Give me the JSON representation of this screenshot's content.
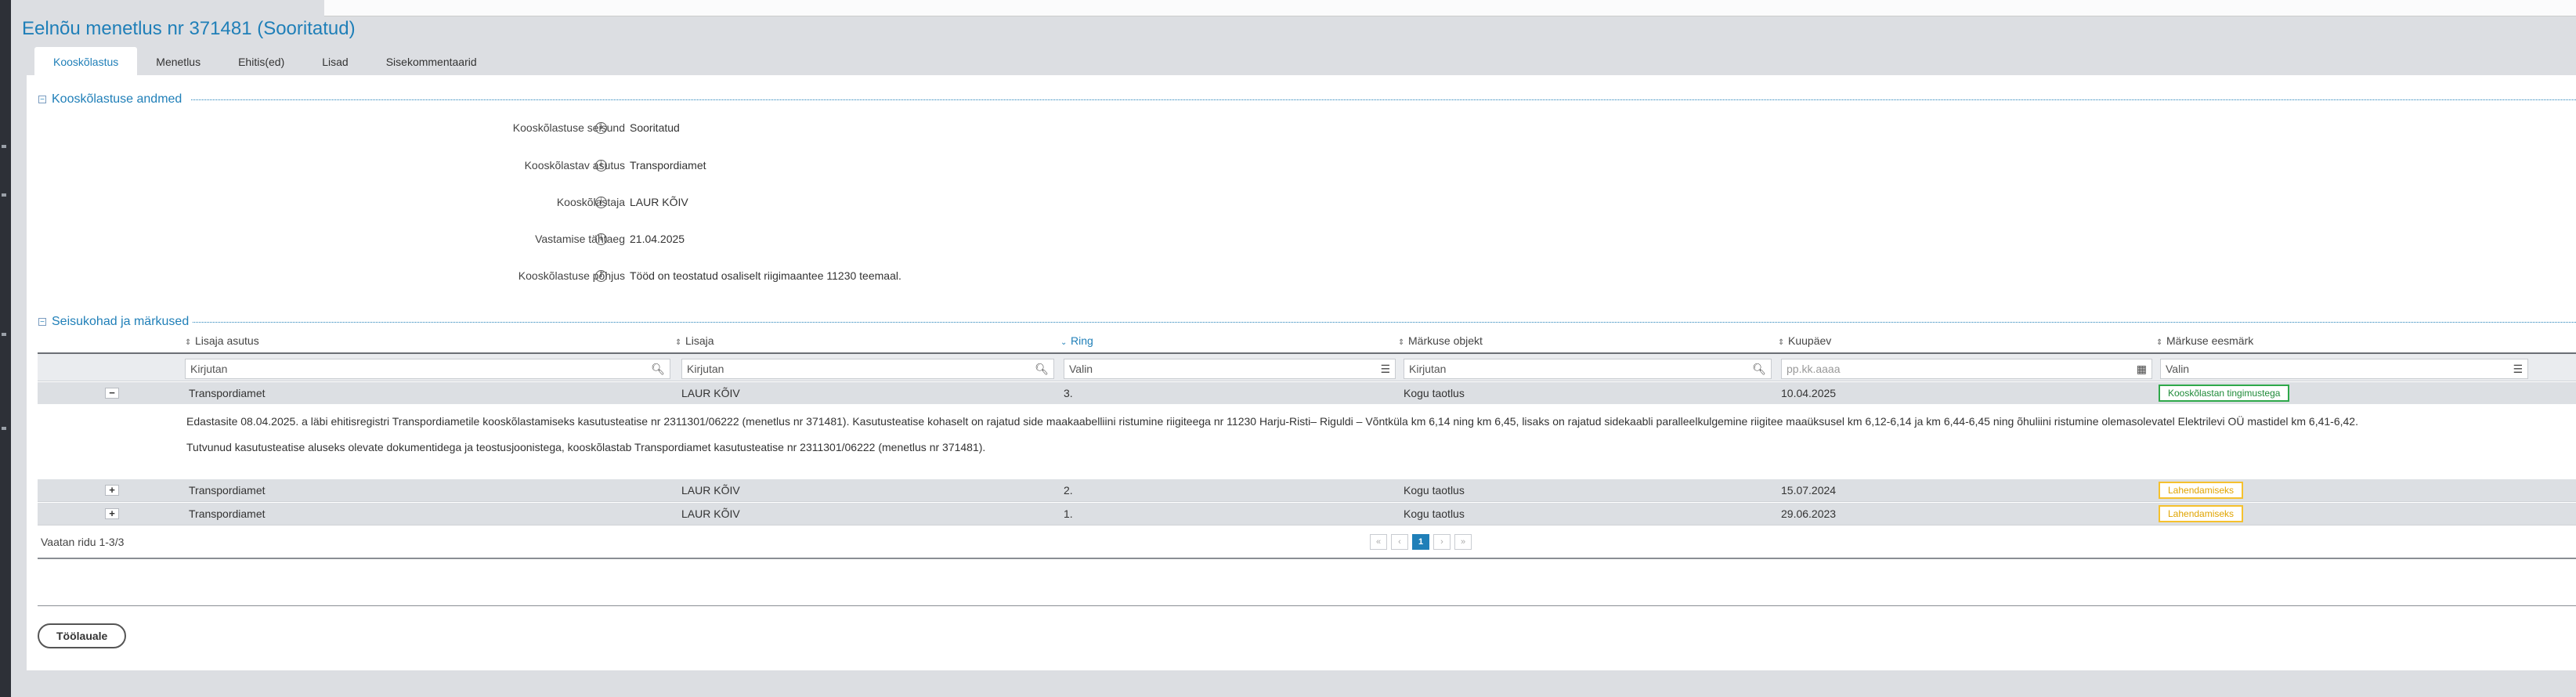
{
  "page": {
    "title": "Eelnõu menetlus nr 371481 (Sooritatud)"
  },
  "tabs": [
    {
      "label": "Kooskõlastus",
      "active": true
    },
    {
      "label": "Menetlus"
    },
    {
      "label": "Ehitis(ed)"
    },
    {
      "label": "Lisad"
    },
    {
      "label": "Sisekommentaarid"
    }
  ],
  "sections": {
    "approval_data": {
      "title": "Kooskõlastuse andmed",
      "fields": [
        {
          "label": "Kooskõlastuse seisund",
          "value": "Sooritatud"
        },
        {
          "label": "Kooskõlastav asutus",
          "value": "Transpordiamet"
        },
        {
          "label": "Kooskõlastaja",
          "value": "LAUR KÕIV"
        },
        {
          "label": "Vastamise tähtaeg",
          "value": "21.04.2025"
        },
        {
          "label": "Kooskõlastuse põhjus",
          "value": "Tööd on teostatud osaliselt riigimaantee 11230 teemaal."
        }
      ]
    },
    "remarks": {
      "title": "Seisukohad ja märkused"
    }
  },
  "grid": {
    "columns": [
      {
        "label": "Lisaja asutus"
      },
      {
        "label": "Lisaja"
      },
      {
        "label": "Ring"
      },
      {
        "label": "Märkuse objekt"
      },
      {
        "label": "Kuupäev"
      },
      {
        "label": "Märkuse eesmärk"
      }
    ],
    "filters": [
      {
        "placeholder": "Kirjutan"
      },
      {
        "placeholder": "Kirjutan"
      },
      {
        "placeholder": "Valin"
      },
      {
        "placeholder": "Kirjutan"
      },
      {
        "placeholder": "pp.kk.aaaa"
      },
      {
        "placeholder": "Valin"
      }
    ],
    "rows": [
      {
        "expander": "−",
        "institution": "Transpordiamet",
        "author": "LAUR KÕIV",
        "round": "3.",
        "object": "Kogu taotlus",
        "date": "10.04.2025",
        "purpose": "Kooskõlastan tingimustega",
        "purpose_color": "#2ea84a"
      },
      {
        "expander": "+",
        "institution": "Transpordiamet",
        "author": "LAUR KÕIV",
        "round": "2.",
        "object": "Kogu taotlus",
        "date": "15.07.2024",
        "purpose": "Lahendamiseks",
        "purpose_color": "#f5c12e"
      },
      {
        "expander": "+",
        "institution": "Transpordiamet",
        "author": "LAUR KÕIV",
        "round": "1.",
        "object": "Kogu taotlus",
        "date": "29.06.2023",
        "purpose": "Lahendamiseks",
        "purpose_color": "#f5c12e"
      }
    ],
    "detail": {
      "line1": "Edastasite 08.04.2025. a läbi ehitisregistri Transpordiametile kooskõlastamiseks kasutusteatise nr 2311301/06222 (menetlus nr 371481). Kasutusteatise kohaselt on rajatud side maakaabelliini ristumine riigiteega nr 11230 Harju-Risti– Riguldi – Võntküla km 6,14 ning km 6,45, lisaks on rajatud sidekaabli paralleelkulgemine riigitee maaüksusel km 6,12-6,14 ja km 6,44-6,45 ning õhuliini ristumine olemasolevatel Elektrilevi OÜ mastidel km 6,41-6,42.",
      "line2": "Tutvunud kasutusteatise aluseks olevate dokumentidega ja teostusjoonistega, kooskõlastab Transpordiamet kasutusteatise nr 2311301/06222 (menetlus nr 371481)."
    },
    "footer_text": "Vaatan ridu 1-3/3",
    "pager": {
      "first": "«",
      "prev": "‹",
      "current": "1",
      "next": "›",
      "last": "»"
    }
  },
  "actions": {
    "back_label": "Töölauale"
  },
  "icons": {
    "search": "magnifier-icon",
    "list": "list-icon",
    "calendar": "calendar-icon",
    "info": "info-icon"
  }
}
